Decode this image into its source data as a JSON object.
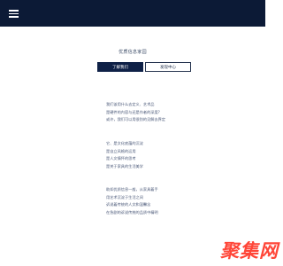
{
  "header": {
    "menu_icon": "hamburger-menu-icon",
    "background_color": "#0c1a36"
  },
  "intro": {
    "title": "优质信息家园",
    "buttons": {
      "primary_label": "了解我们",
      "secondary_label": "发现中心"
    }
  },
  "paragraphs": [
    {
      "lines": [
        "我们该用什么去定义、艺术品",
        "是硬件的内容与还是作者的深度?",
        "或许，我们可以用很别的见解去界定"
      ]
    },
    {
      "lines": [
        "它、是文化底蕴的沉淀",
        "是自立风格的运用",
        "是人文情怀的思考",
        "是关于家具的生活美学"
      ]
    },
    {
      "lines": [
        "助如优质信息一般，从家具着手",
        "用艺术沉淀于生活之间",
        "诉说着传统的人文和温馨念",
        "在急剧的诉说传统的品质中精明"
      ]
    }
  ],
  "watermark": {
    "text": "聚集网",
    "color": "#ff3d2e"
  }
}
